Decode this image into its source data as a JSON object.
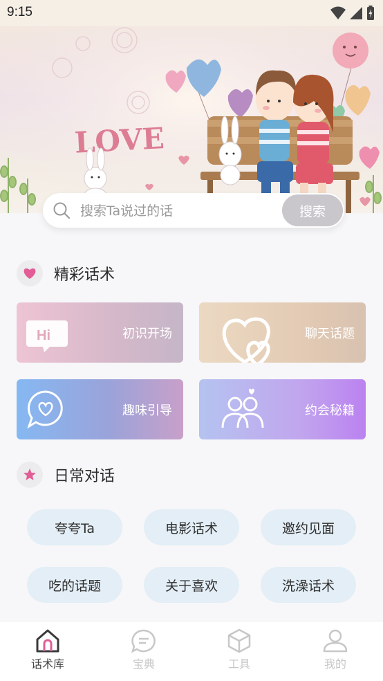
{
  "status_bar": {
    "time": "9:15"
  },
  "banner": {
    "love_text": "LOVE"
  },
  "search": {
    "placeholder": "搜索Ta说过的话",
    "button_label": "搜索"
  },
  "featured": {
    "title": "精彩话术",
    "cards": [
      {
        "label": "初识开场",
        "icon": "hi-bubble-icon"
      },
      {
        "label": "聊天话题",
        "icon": "hearts-icon"
      },
      {
        "label": "趣味引导",
        "icon": "heart-bubble-icon"
      },
      {
        "label": "约会秘籍",
        "icon": "couple-icon"
      }
    ]
  },
  "daily": {
    "title": "日常对话",
    "chips": [
      "夸夸Ta",
      "电影话术",
      "邀约见面",
      "吃的话题",
      "关于喜欢",
      "洗澡话术"
    ]
  },
  "tabbar": {
    "tabs": [
      {
        "label": "话术库",
        "icon": "home-icon",
        "active": true
      },
      {
        "label": "宝典",
        "icon": "chat-bubble-icon",
        "active": false
      },
      {
        "label": "工具",
        "icon": "cube-icon",
        "active": false
      },
      {
        "label": "我的",
        "icon": "user-icon",
        "active": false
      }
    ]
  },
  "colors": {
    "accent_pink": "#e25c95",
    "search_button": "#c9c6cc",
    "chip_bg": "#e3eef6"
  }
}
